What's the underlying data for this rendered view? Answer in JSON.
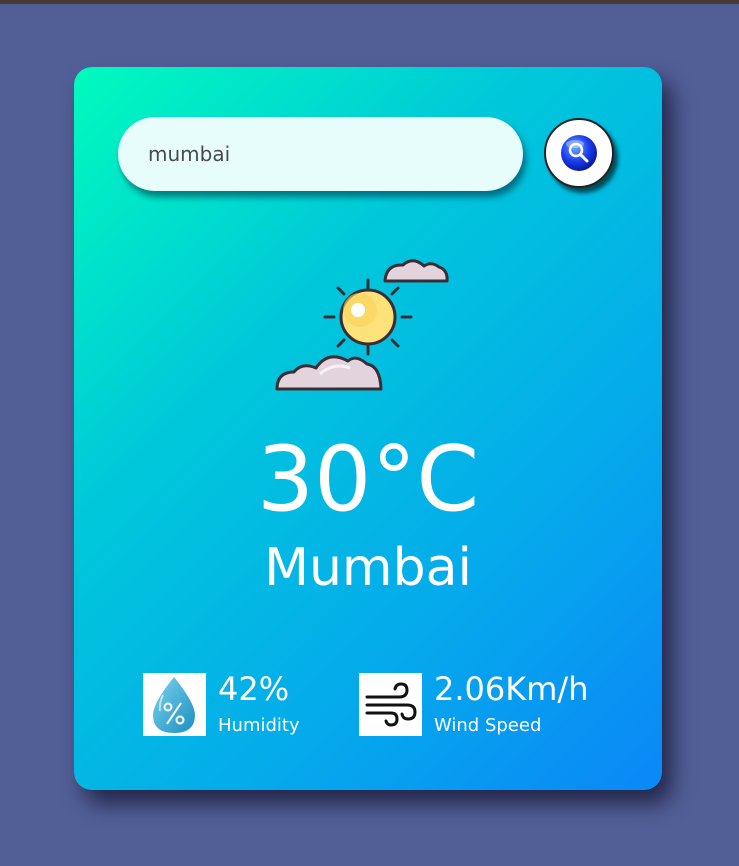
{
  "search": {
    "value": "mumbai",
    "button_icon": "magnifier-icon"
  },
  "weather": {
    "icon": "sun-behind-clouds-icon",
    "temperature": "30°C",
    "city": "Mumbai"
  },
  "details": {
    "humidity": {
      "icon": "humidity-drop-icon",
      "value": "42%",
      "label": "Humidity"
    },
    "wind": {
      "icon": "wind-icon",
      "value": "2.06Km/h",
      "label": "Wind Speed"
    }
  },
  "colors": {
    "background": "#525f97",
    "card_gradient_start": "#00fbbd",
    "card_gradient_end": "#0b87f7",
    "input_bg": "#e6fdfc",
    "text": "#ffffff"
  }
}
